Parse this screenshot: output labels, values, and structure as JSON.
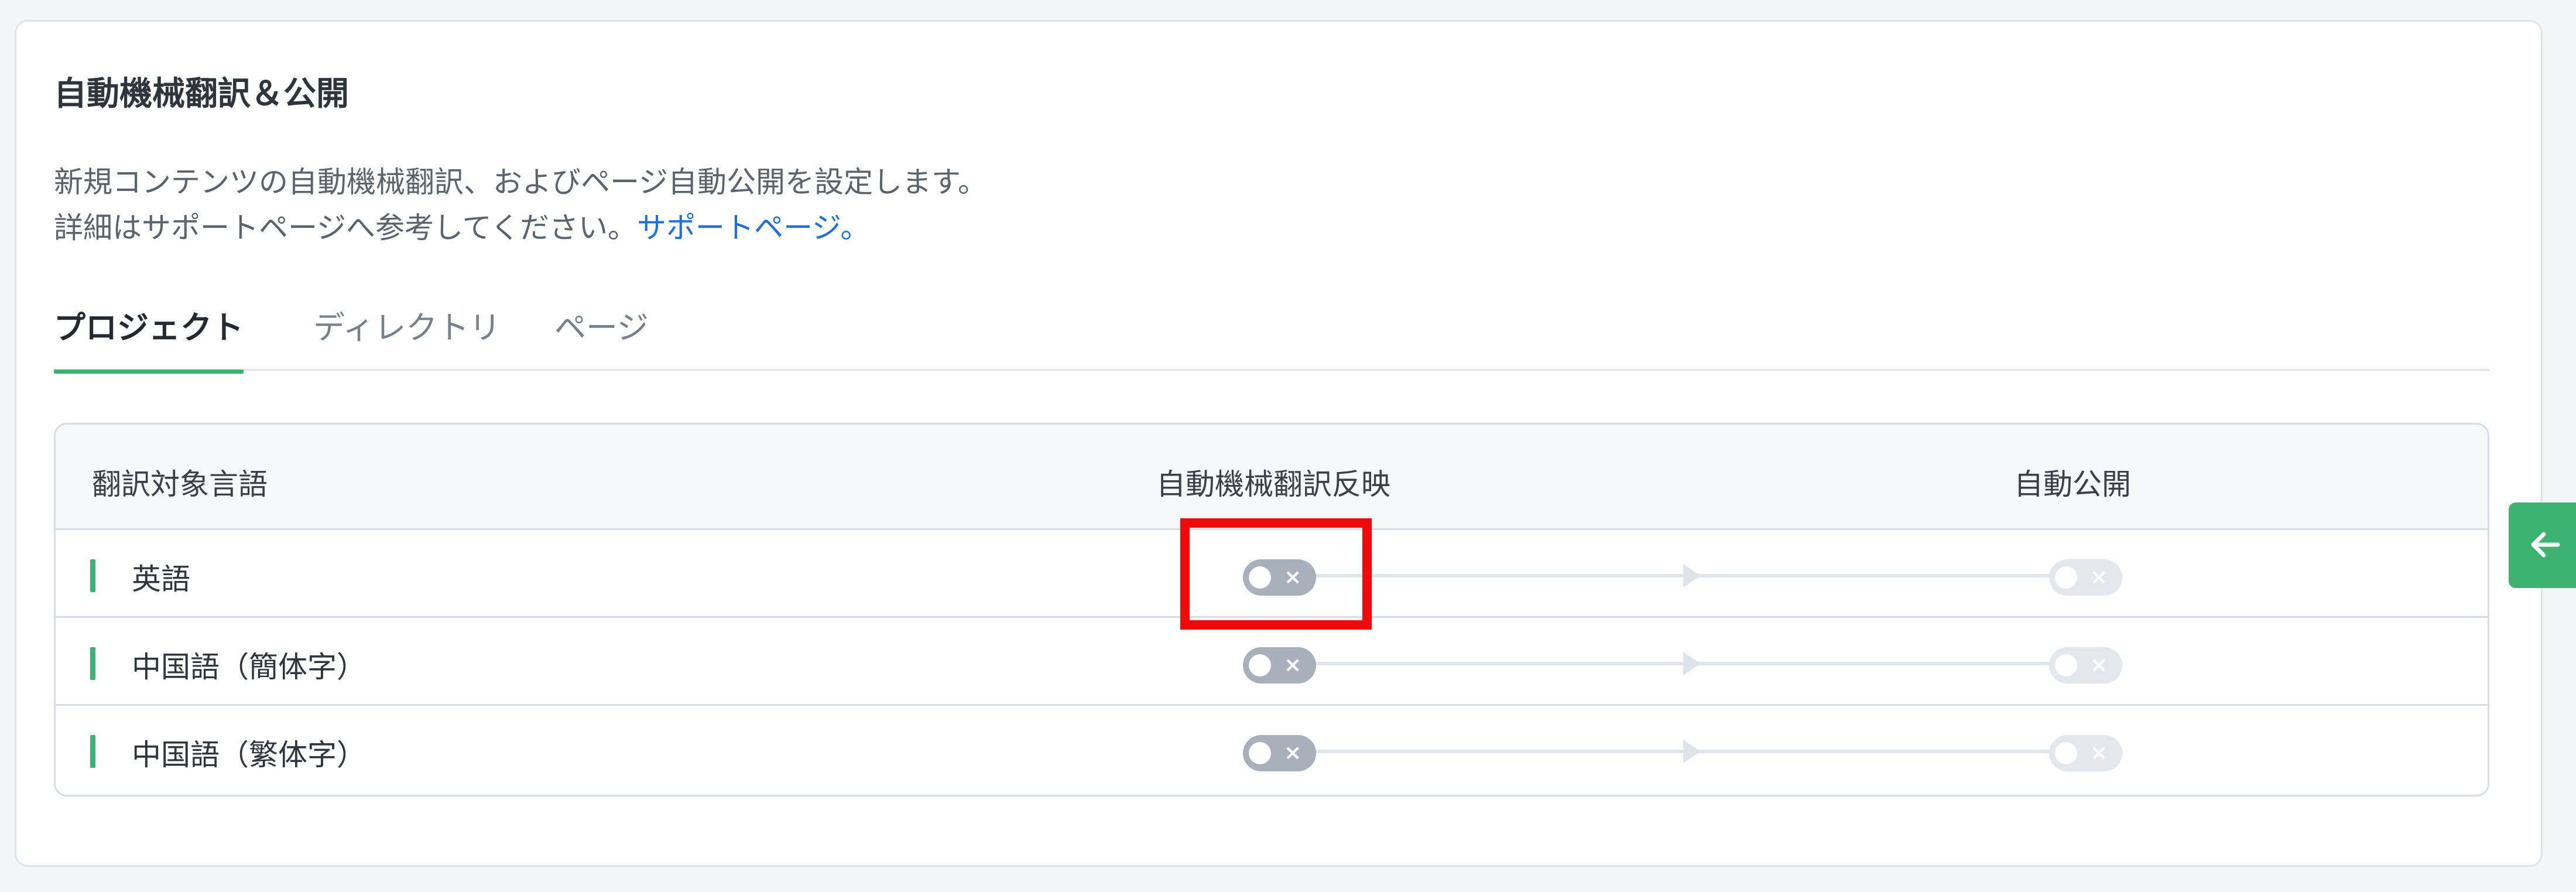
{
  "section": {
    "title": "自動機械翻訳＆公開",
    "description_line1": "新規コンテンツの自動機械翻訳、およびページ自動公開を設定します。",
    "description_line2": "詳細はサポートページへ参考してください。",
    "support_link": "サポートページ。"
  },
  "tabs": [
    {
      "label": "プロジェクト",
      "active": true
    },
    {
      "label": "ディレクトリ",
      "active": false
    },
    {
      "label": "ページ",
      "active": false
    }
  ],
  "table": {
    "headers": [
      "翻訳対象言語",
      "自動機械翻訳反映",
      "自動公開"
    ],
    "rows": [
      {
        "language": "英語",
        "auto_mt": "off",
        "auto_publish": "off (disabled)"
      },
      {
        "language": "中国語（簡体字）",
        "auto_mt": "off",
        "auto_publish": "off (disabled)"
      },
      {
        "language": "中国語（繁体字）",
        "auto_mt": "off",
        "auto_publish": "off (disabled)"
      }
    ]
  },
  "toggle_off_glyph": "×",
  "colors": {
    "accent_green": "#3cb371",
    "link_blue": "#1e6fd9",
    "highlight_red": "#ee0a0a",
    "toggle_off": "#a7b0bb",
    "toggle_disabled": "#e4e8ee"
  },
  "icons": {
    "side_button": "arrow-left-icon"
  }
}
